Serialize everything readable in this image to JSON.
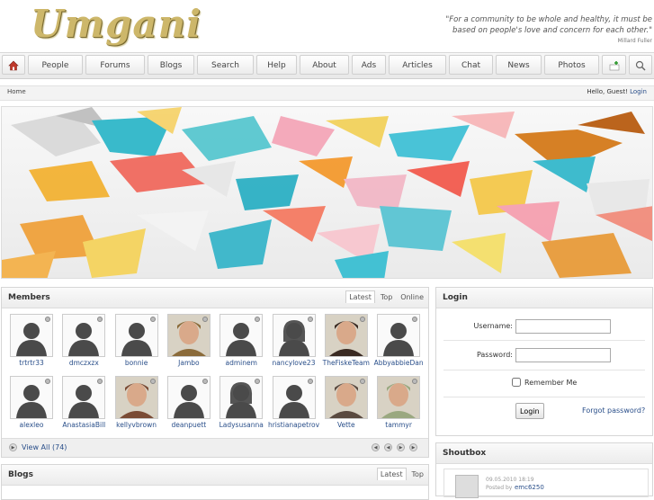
{
  "header": {
    "logo_text": "Umgani",
    "quote_line1": "\"For a community to be whole and healthy, it must be",
    "quote_line2": "based on people's love and concern for each other.\"",
    "quote_author": "Millard Fuller"
  },
  "nav": {
    "items": [
      "People",
      "Forums",
      "Blogs",
      "Search",
      "Help",
      "About",
      "Ads",
      "Articles",
      "Chat",
      "News",
      "Photos"
    ],
    "home_icon": "home-icon",
    "add_icon": "add-icon",
    "search_icon": "search-icon"
  },
  "breadcrumb": {
    "home": "Home",
    "greeting": "Hello, Guest!",
    "login_link": "Login"
  },
  "members": {
    "title": "Members",
    "tabs": [
      "Latest",
      "Top",
      "Online"
    ],
    "view_all": "View All (74)",
    "people": [
      "trtrtr33",
      "dmczxzx",
      "bonnie",
      "Jambo",
      "adminem",
      "nancylove23",
      "TheFiskeTeam",
      "AbbyabbieDan",
      "alexleo",
      "AnastasiaBill",
      "kellyvbrown",
      "deanpuett",
      "Ladysusanna",
      "hristianapetrov",
      "Vette",
      "tammyr"
    ]
  },
  "login": {
    "title": "Login",
    "username_label": "Username:",
    "password_label": "Password:",
    "remember_label": "Remember Me",
    "button_label": "Login",
    "forgot_label": "Forgot password?"
  },
  "blogs": {
    "title": "Blogs",
    "tabs": [
      "Latest",
      "Top"
    ]
  },
  "shoutbox": {
    "title": "Shoutbox",
    "entry_date": "09.05.2010 18:19",
    "entry_posted_by": "Posted by",
    "entry_author": "emc6250"
  }
}
